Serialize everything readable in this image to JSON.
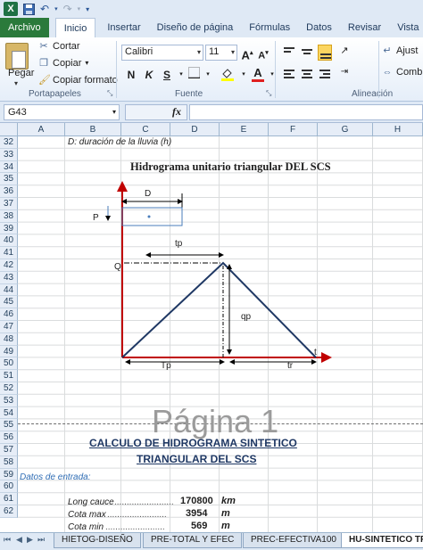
{
  "quick_access": {
    "excel_logo": "X",
    "save_icon": "save-icon",
    "undo_icon": "undo-icon",
    "redo_icon": "redo-icon"
  },
  "tabs": [
    "Archivo",
    "Inicio",
    "Insertar",
    "Diseño de página",
    "Fórmulas",
    "Datos",
    "Revisar",
    "Vista"
  ],
  "ribbon": {
    "paste_label": "Pegar",
    "cut_label": "Cortar",
    "copy_label": "Copiar",
    "format_painter_label": "Copiar formato",
    "clipboard_group": "Portapapeles",
    "font_name": "Calibri",
    "font_size": "11",
    "bold": "N",
    "italic": "K",
    "underline": "S",
    "font_group": "Fuente",
    "alignment_group": "Alineación",
    "wrap_label": "Ajust",
    "merge_label": "Comb"
  },
  "formula_bar": {
    "cell_ref": "G43",
    "fx_label": "fx",
    "formula": ""
  },
  "columns": [
    "A",
    "B",
    "C",
    "D",
    "E",
    "F",
    "G",
    "H"
  ],
  "rows": [
    32,
    33,
    34,
    35,
    36,
    37,
    38,
    39,
    40,
    41,
    42,
    43,
    44,
    45,
    46,
    47,
    48,
    49,
    50,
    51,
    52,
    53,
    54,
    55,
    56,
    57,
    58,
    59,
    60,
    61,
    62
  ],
  "cells": {
    "b32": "D: duración de la lluvia (h)",
    "diagram_title": "Hidrograma unitario triangular DEL SCS",
    "page_watermark": "Página 1",
    "calc_title_1": "CALCULO DE HIDROGRAMA SINTETICO",
    "calc_title_2": "TRIANGULAR DEL SCS",
    "datos_entrada": "Datos de entrada:",
    "long_cauce_label": "Long cauce",
    "long_cauce_value": "170800",
    "long_cauce_unit": "km",
    "cota_max_label": "Cota max",
    "cota_max_value": "3954",
    "cota_max_unit": "m",
    "cota_min_label": "Cota min",
    "cota_min_value": "569",
    "cota_min_unit": "m",
    "dots": "........................"
  },
  "diagram_labels": {
    "D": "D",
    "P": "P",
    "tp": "tp",
    "Q": "Q",
    "qp": "qp",
    "t": "t",
    "Tp": "Tp",
    "tr": "tr"
  },
  "sheet_tabs": [
    "HIETOG-DISEÑO",
    "PRE-TOTAL Y EFEC",
    "PREC-EFECTIVA100",
    "HU-SINTETICO TRI"
  ],
  "active_sheet": "HU-SINTETICO TRI"
}
